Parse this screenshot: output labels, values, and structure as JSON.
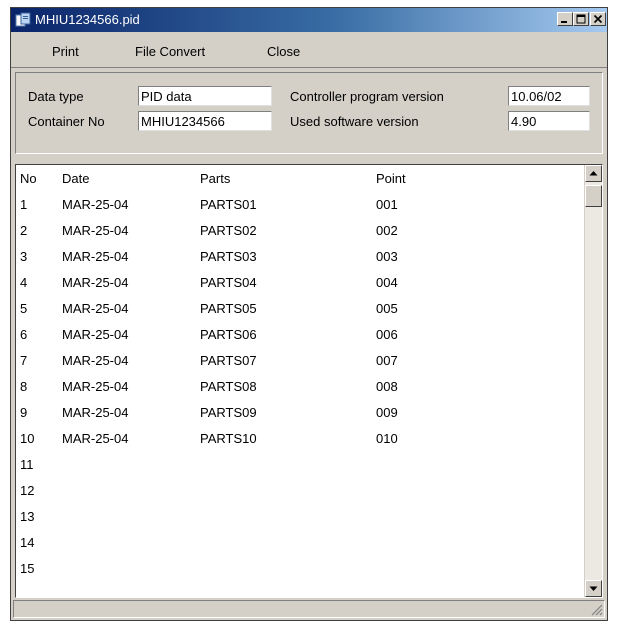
{
  "window": {
    "title": "MHIU1234566.pid",
    "app_icon": "app-document-icon",
    "controls": [
      "minimize-icon",
      "maximize-icon",
      "close-icon"
    ]
  },
  "menu": {
    "print": "Print",
    "file_convert": "File Convert",
    "close": "Close"
  },
  "info": {
    "data_type_label": "Data type",
    "data_type_value": "PID data",
    "container_no_label": "Container No",
    "container_no_value": "MHIU1234566",
    "controller_version_label": "Controller program version",
    "controller_version_value": "10.06/02",
    "software_version_label": "Used software version",
    "software_version_value": "4.90"
  },
  "list": {
    "columns": {
      "no": "No",
      "date": "Date",
      "parts": "Parts",
      "point": "Point"
    },
    "rows": [
      {
        "no": "1",
        "date": "MAR-25-04",
        "parts": "PARTS01",
        "point": "001"
      },
      {
        "no": "2",
        "date": "MAR-25-04",
        "parts": "PARTS02",
        "point": "002"
      },
      {
        "no": "3",
        "date": "MAR-25-04",
        "parts": "PARTS03",
        "point": "003"
      },
      {
        "no": "4",
        "date": "MAR-25-04",
        "parts": "PARTS04",
        "point": "004"
      },
      {
        "no": "5",
        "date": "MAR-25-04",
        "parts": "PARTS05",
        "point": "005"
      },
      {
        "no": "6",
        "date": "MAR-25-04",
        "parts": "PARTS06",
        "point": "006"
      },
      {
        "no": "7",
        "date": "MAR-25-04",
        "parts": "PARTS07",
        "point": "007"
      },
      {
        "no": "8",
        "date": "MAR-25-04",
        "parts": "PARTS08",
        "point": "008"
      },
      {
        "no": "9",
        "date": "MAR-25-04",
        "parts": "PARTS09",
        "point": "009"
      },
      {
        "no": "10",
        "date": "MAR-25-04",
        "parts": "PARTS10",
        "point": "010"
      },
      {
        "no": "11",
        "date": "",
        "parts": "",
        "point": ""
      },
      {
        "no": "12",
        "date": "",
        "parts": "",
        "point": ""
      },
      {
        "no": "13",
        "date": "",
        "parts": "",
        "point": ""
      },
      {
        "no": "14",
        "date": "",
        "parts": "",
        "point": ""
      },
      {
        "no": "15",
        "date": "",
        "parts": "",
        "point": ""
      }
    ]
  },
  "colors": {
    "window_face": "#d4d0c8",
    "titlebar_start": "#0a246a",
    "titlebar_end": "#a6caf0"
  }
}
